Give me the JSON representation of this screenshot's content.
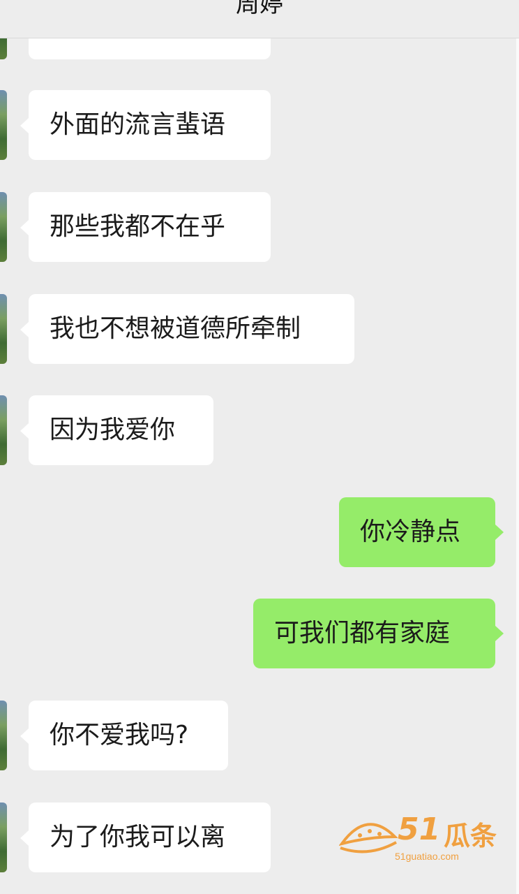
{
  "header": {
    "title": "周婷"
  },
  "messages": [
    {
      "side": "left",
      "text": "",
      "top": 0
    },
    {
      "side": "left",
      "text": "外面的流言蜚语"
    },
    {
      "side": "left",
      "text": "那些我都不在乎"
    },
    {
      "side": "left",
      "text": "我也不想被道德所牵制"
    },
    {
      "side": "left",
      "text": "因为我爱你"
    },
    {
      "side": "right",
      "text": "你冷静点"
    },
    {
      "side": "right",
      "text": "可我们都有家庭"
    },
    {
      "side": "left",
      "text": "你不爱我吗?"
    },
    {
      "side": "left",
      "text": "为了你我可以离"
    }
  ],
  "watermark": {
    "number": "51",
    "name": "瓜条",
    "url": "51guatiao.com"
  },
  "colors": {
    "background": "#ededed",
    "incoming": "#ffffff",
    "outgoing": "#95ec69",
    "watermark": "#f0a040"
  }
}
